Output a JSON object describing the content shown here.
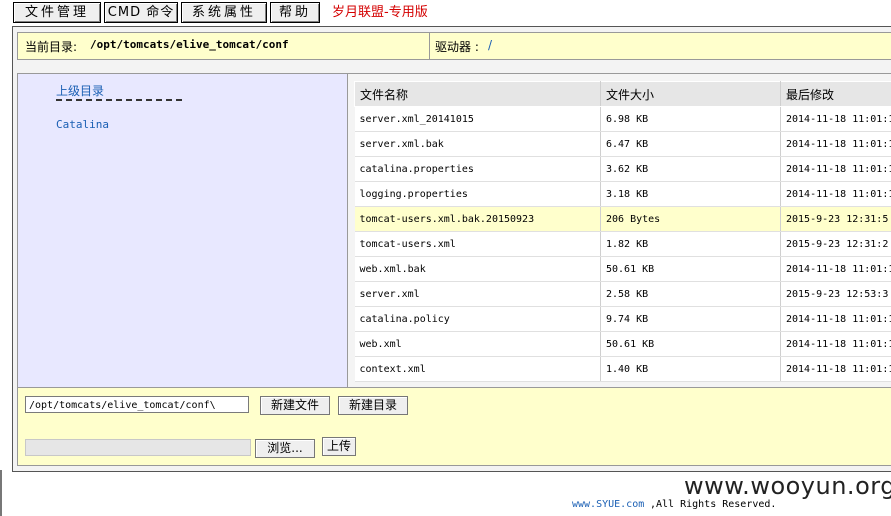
{
  "nav": {
    "tabs": [
      "文件管理",
      "CMD 命令",
      "系统属性",
      "帮助"
    ],
    "brand": "岁月联盟-专用版"
  },
  "pathbar": {
    "current_label": "当前目录:",
    "current_path": "/opt/tomcats/elive_tomcat/conf",
    "drive_label": "驱动器 :",
    "drive_value": "/"
  },
  "sidebar": {
    "up_label": "上级目录",
    "dirs": [
      "Catalina"
    ]
  },
  "files": {
    "columns": [
      "文件名称",
      "文件大小",
      "最后修改"
    ],
    "rows": [
      {
        "name": "server.xml_20141015",
        "size": "6.98 KB",
        "modified": "2014-11-18 11:01:1"
      },
      {
        "name": "server.xml.bak",
        "size": "6.47 KB",
        "modified": "2014-11-18 11:01:1"
      },
      {
        "name": "catalina.properties",
        "size": "3.62 KB",
        "modified": "2014-11-18 11:01:1"
      },
      {
        "name": "logging.properties",
        "size": "3.18 KB",
        "modified": "2014-11-18 11:01:1"
      },
      {
        "name": "tomcat-users.xml.bak.20150923",
        "size": "206 Bytes",
        "modified": "2015-9-23 12:31:5"
      },
      {
        "name": "tomcat-users.xml",
        "size": "1.82 KB",
        "modified": "2015-9-23 12:31:2"
      },
      {
        "name": "web.xml.bak",
        "size": "50.61 KB",
        "modified": "2014-11-18 11:01:1"
      },
      {
        "name": "server.xml",
        "size": "2.58 KB",
        "modified": "2015-9-23 12:53:3"
      },
      {
        "name": "catalina.policy",
        "size": "9.74 KB",
        "modified": "2014-11-18 11:01:1"
      },
      {
        "name": "web.xml",
        "size": "50.61 KB",
        "modified": "2014-11-18 11:01:1"
      },
      {
        "name": "context.xml",
        "size": "1.40 KB",
        "modified": "2014-11-18 11:01:1"
      }
    ],
    "highlight_color": "#ffffcc"
  },
  "actions": {
    "path_value": "/opt/tomcats/elive_tomcat/conf\\",
    "new_file": "新建文件",
    "new_dir": "新建目录",
    "browse": "浏览...",
    "upload": "上传"
  },
  "footer": {
    "link": "www.SYUE.com",
    "text": ",All Rights Reserved.",
    "watermark": "www.wooyun.org"
  },
  "colors": {
    "accent_link": "#1a5fb4",
    "brand": "#d40000",
    "panel_yellow": "#ffffcc",
    "sidebar_bg": "#e8e8ff"
  }
}
